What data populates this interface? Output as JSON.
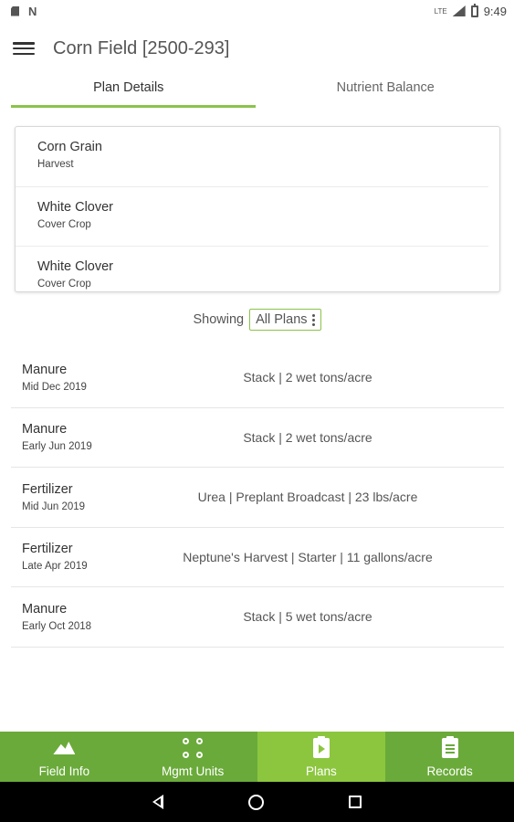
{
  "status_bar": {
    "time": "9:49",
    "lte_label": "LTE",
    "icons": [
      "sd-card-icon",
      "n-notification-icon",
      "signal-icon",
      "battery-icon"
    ]
  },
  "app_bar": {
    "title": "Corn Field [2500-293]",
    "menu_icon": "hamburger-menu-icon"
  },
  "tabs": [
    {
      "label": "Plan Details",
      "active": true
    },
    {
      "label": "Nutrient Balance",
      "active": false
    }
  ],
  "crops": [
    {
      "name": "Corn Grain",
      "type": "Harvest"
    },
    {
      "name": "White Clover",
      "type": "Cover Crop"
    },
    {
      "name": "White Clover",
      "type": "Cover Crop"
    }
  ],
  "filter": {
    "label": "Showing",
    "selected": "All Plans"
  },
  "plans": [
    {
      "type": "Manure",
      "date": "Mid Dec 2019",
      "detail": "Stack | 2 wet tons/acre"
    },
    {
      "type": "Manure",
      "date": "Early Jun 2019",
      "detail": "Stack | 2 wet tons/acre"
    },
    {
      "type": "Fertilizer",
      "date": "Mid Jun 2019",
      "detail": "Urea | Preplant Broadcast | 23 lbs/acre"
    },
    {
      "type": "Fertilizer",
      "date": "Late Apr 2019",
      "detail": "Neptune's Harvest | Starter | 11 gallons/acre"
    },
    {
      "type": "Manure",
      "date": "Early Oct 2018",
      "detail": "Stack | 5 wet tons/acre"
    }
  ],
  "bottom_nav": [
    {
      "label": "Field Info",
      "icon": "mountain-icon",
      "active": false
    },
    {
      "label": "Mgmt Units",
      "icon": "units-icon",
      "active": false
    },
    {
      "label": "Plans",
      "icon": "clipboard-play-icon",
      "active": true
    },
    {
      "label": "Records",
      "icon": "clipboard-list-icon",
      "active": false
    }
  ],
  "colors": {
    "accent": "#8bc34a",
    "nav_bg": "#6aaa3a",
    "nav_active": "#8cc63f"
  }
}
